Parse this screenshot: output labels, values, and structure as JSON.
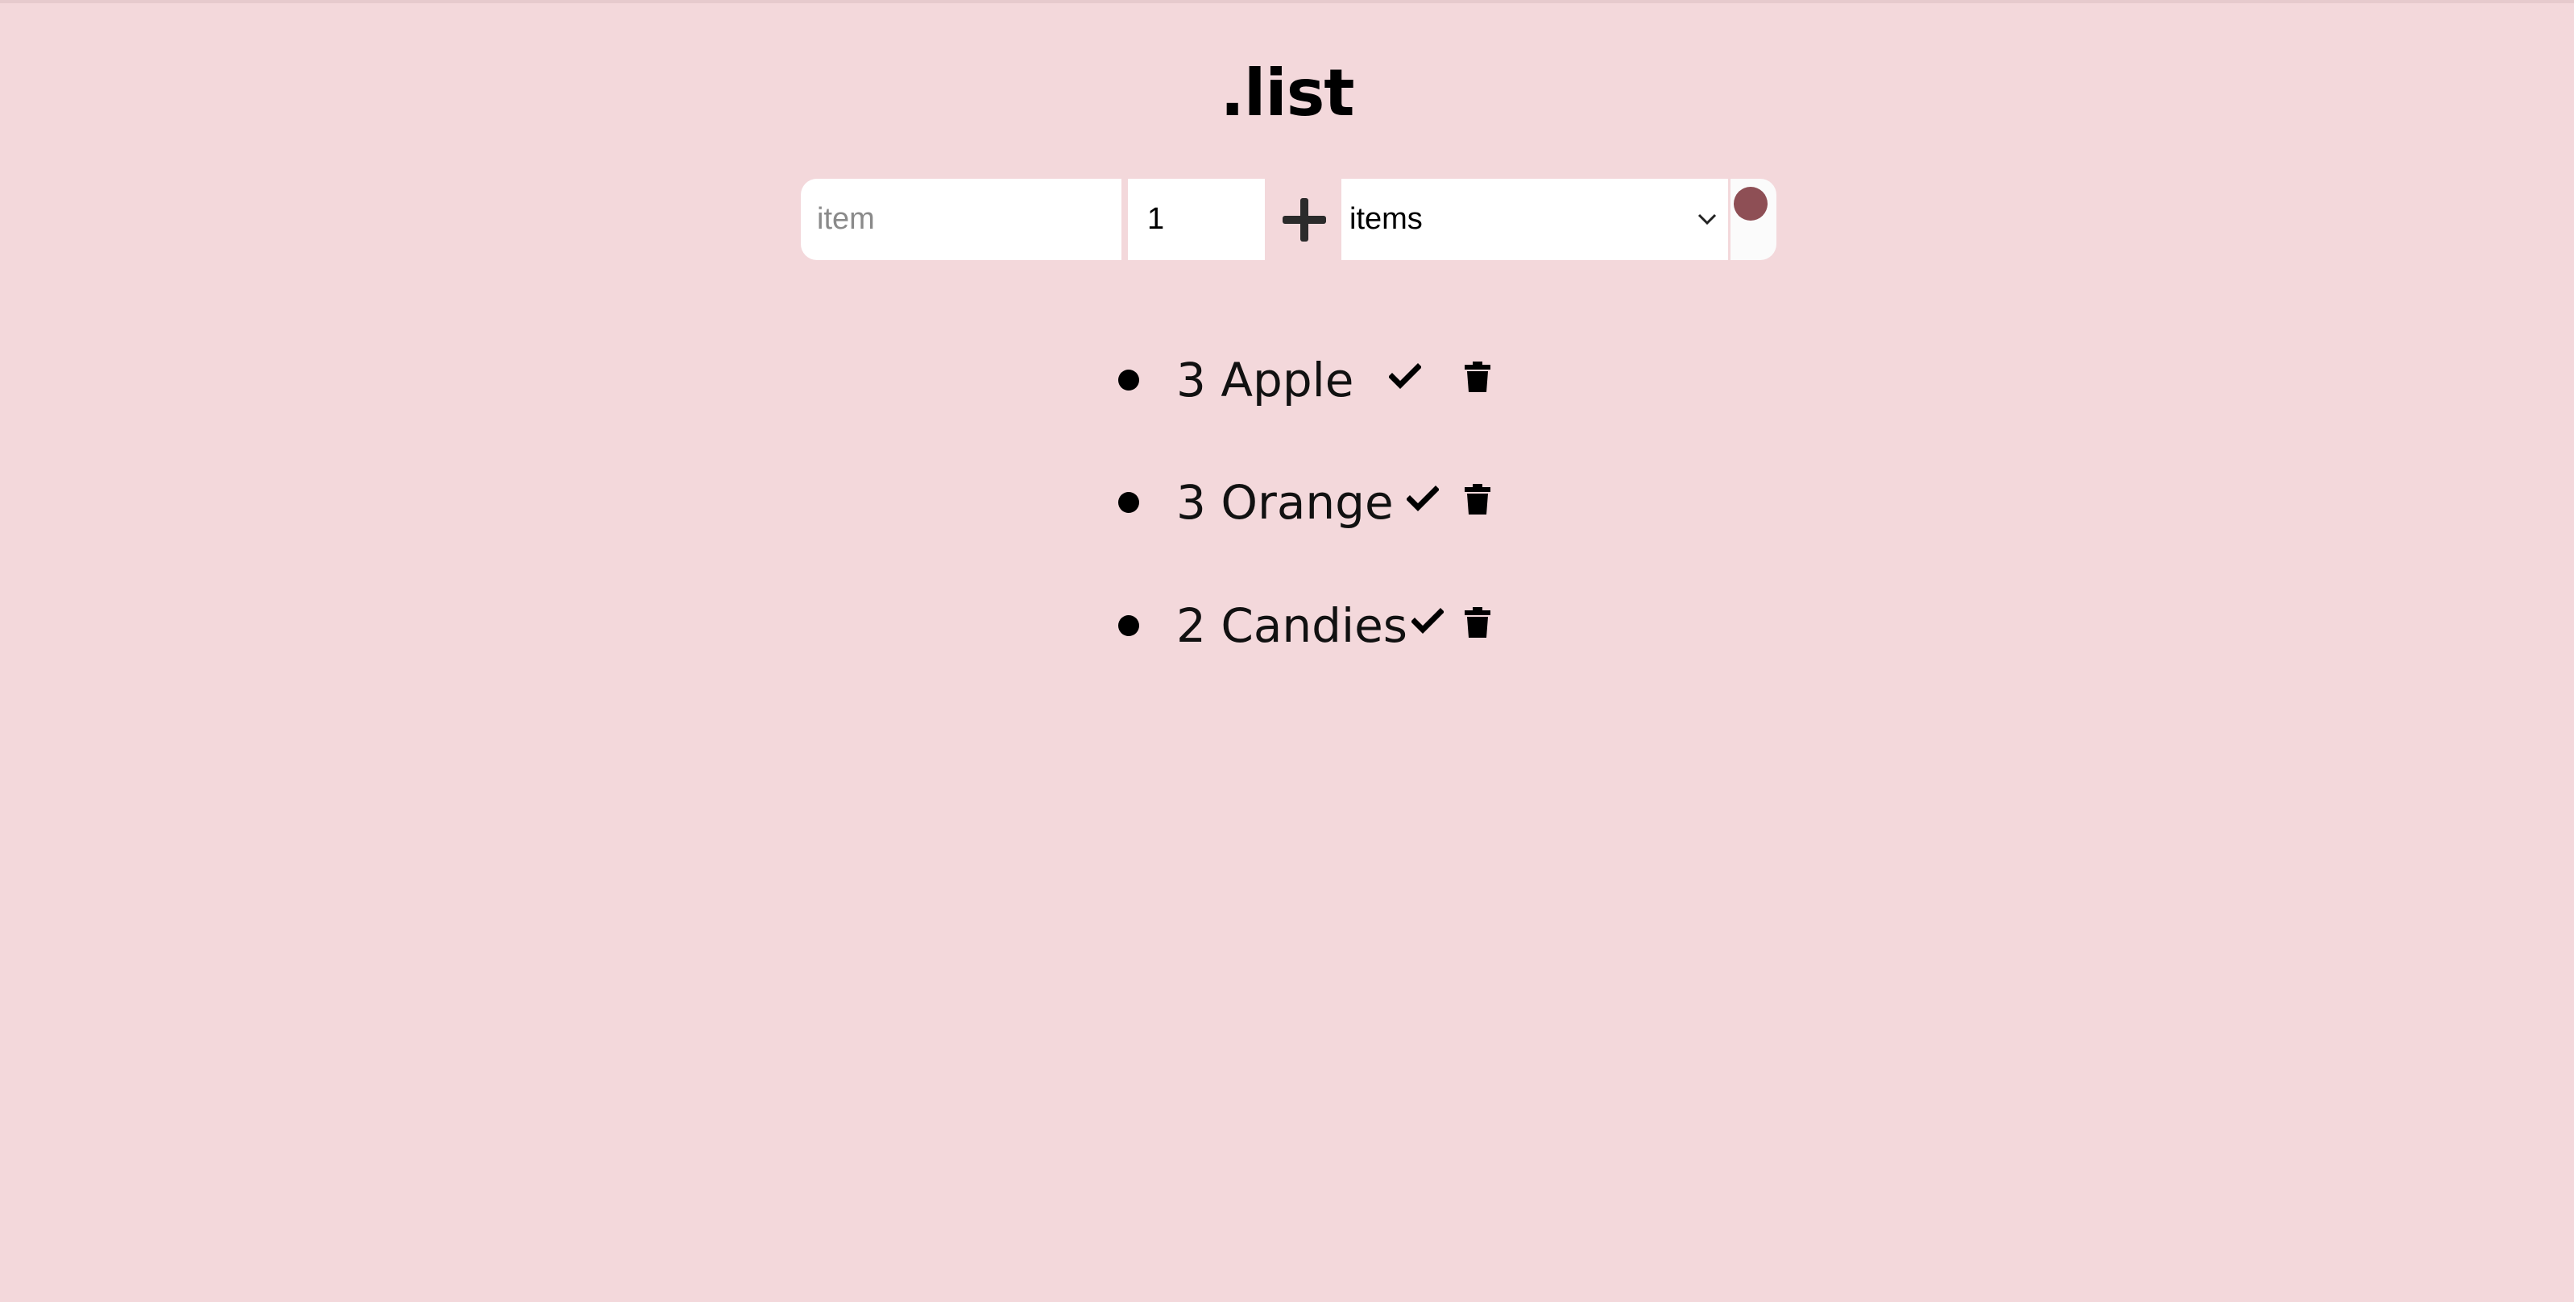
{
  "header": {
    "title": ".list"
  },
  "form": {
    "item_placeholder": "item",
    "quantity_value": "1",
    "unit_selected": "items",
    "color": "#8e4f55"
  },
  "list": {
    "items": [
      {
        "text": "3 Apple"
      },
      {
        "text": "3 Orange"
      },
      {
        "text": "2 Candies"
      }
    ]
  },
  "colors": {
    "background": "#f3d8db",
    "accent": "#8e4f55"
  },
  "icons": {
    "add": "plus-icon",
    "unit_dropdown": "chevron-down-icon",
    "check": "check-icon",
    "delete": "trash-icon"
  }
}
